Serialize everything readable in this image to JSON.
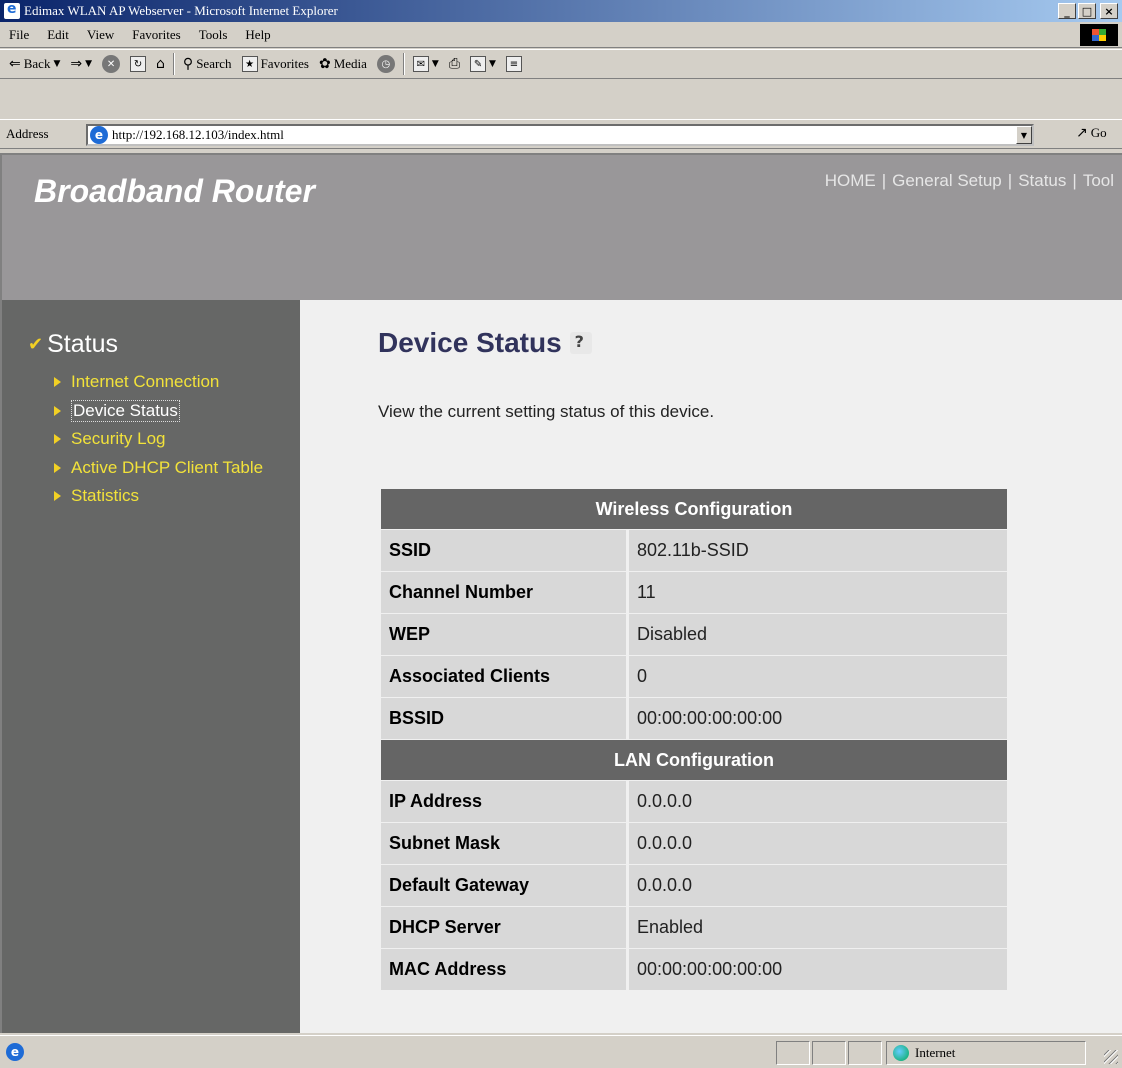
{
  "window": {
    "title": "Edimax WLAN AP Webserver - Microsoft Internet Explorer",
    "controls": [
      "_",
      "□",
      "×"
    ]
  },
  "menu": [
    "File",
    "Edit",
    "View",
    "Favorites",
    "Tools",
    "Help"
  ],
  "toolbar": {
    "back": "Back",
    "search": "Search",
    "favorites": "Favorites",
    "media": "Media"
  },
  "address": {
    "label": "Address",
    "url": "http://192.168.12.103/index.html",
    "go": "Go"
  },
  "header": {
    "brand": "Broadband Router",
    "nav": [
      "HOME",
      "General Setup",
      "Status",
      "Tool"
    ]
  },
  "sidebar": {
    "title": "Status",
    "items": [
      {
        "label": "Internet Connection"
      },
      {
        "label": "Device Status"
      },
      {
        "label": "Security Log"
      },
      {
        "label": "Active DHCP Client Table"
      },
      {
        "label": "Statistics"
      }
    ]
  },
  "content": {
    "title": "Device Status",
    "description": "View the current setting status of this device.",
    "wireless": {
      "heading": "Wireless Configuration",
      "rows": [
        {
          "key": "SSID",
          "value": "802.11b-SSID"
        },
        {
          "key": "Channel Number",
          "value": "11"
        },
        {
          "key": "WEP",
          "value": "Disabled"
        },
        {
          "key": "Associated Clients",
          "value": "0"
        },
        {
          "key": "BSSID",
          "value": "00:00:00:00:00:00"
        }
      ]
    },
    "lan": {
      "heading": "LAN Configuration",
      "rows": [
        {
          "key": "IP Address",
          "value": "0.0.0.0"
        },
        {
          "key": "Subnet Mask",
          "value": "0.0.0.0"
        },
        {
          "key": "Default Gateway",
          "value": "0.0.0.0"
        },
        {
          "key": "DHCP Server",
          "value": " Enabled"
        },
        {
          "key": "MAC Address",
          "value": "00:00:00:00:00:00"
        }
      ]
    }
  },
  "statusbar": {
    "zone": "Internet"
  },
  "colors": {
    "header_bg": "#999799",
    "sidebar_bg": "#666766",
    "sidebar_link": "#f2e23a",
    "table_header": "#656565",
    "table_cell": "#d8d8d8",
    "title_color": "#31335c"
  }
}
